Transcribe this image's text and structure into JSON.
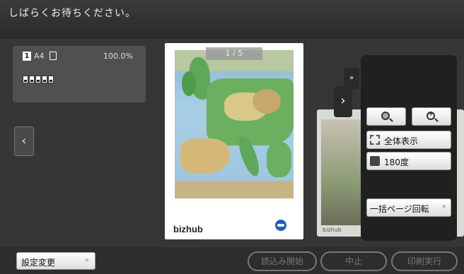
{
  "topbar": {
    "status_message": "しばらくお待ちください。"
  },
  "info_panel": {
    "page_number": "1",
    "paper_size": "A4",
    "zoom": "100.0%"
  },
  "preview": {
    "page_counter": "1  /  5",
    "brand": "bizhub",
    "reflection_brand": "bizhub",
    "next_page_brand": "bizhub"
  },
  "navigation": {
    "prev_glyph": "‹",
    "next_glyph": "›",
    "collapse_glyph": "»"
  },
  "tools": {
    "fit_label": "全体表示",
    "rotate_label": "180度",
    "batch_rotate_label": "一括ページ回転",
    "arrow_glyph": "»"
  },
  "bottom": {
    "settings_label": "設定変更",
    "arrow_glyph": "»",
    "start_label": "読込み開始",
    "stop_label": "中止",
    "print_label": "印刷実行"
  },
  "icons": [
    "page-icon",
    "thumbnail-icon",
    "zoom-out-icon",
    "zoom-in-icon",
    "fit-icon",
    "rotate-icon",
    "logo-icon"
  ]
}
